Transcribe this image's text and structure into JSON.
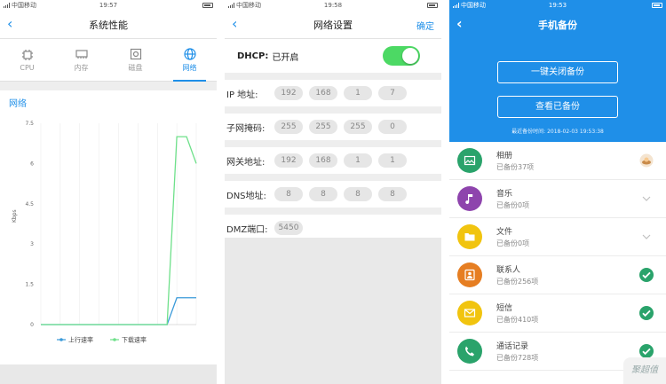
{
  "screen1": {
    "status": {
      "carrier": "中国移动",
      "time": "19:57"
    },
    "title": "系统性能",
    "tabs": [
      {
        "label": "CPU",
        "icon": "cpu-icon"
      },
      {
        "label": "内存",
        "icon": "memory-icon"
      },
      {
        "label": "磁盘",
        "icon": "disk-icon"
      },
      {
        "label": "网络",
        "icon": "globe-icon",
        "active": true
      }
    ],
    "section_title": "网络",
    "chart_data": {
      "type": "line",
      "ylabel": "Kbps",
      "ylim": [
        0,
        7.5
      ],
      "yticks": [
        "0",
        "1.5",
        "3",
        "4.5",
        "6",
        "7.5"
      ],
      "grid": "vertical",
      "legend_position": "bottom",
      "x": [
        0,
        1,
        2,
        3,
        4,
        5,
        6,
        7,
        8,
        9,
        10,
        11,
        12,
        13,
        14,
        15,
        16
      ],
      "series": [
        {
          "name": "上行速率",
          "color": "#3a9ad9",
          "values": [
            0,
            0,
            0,
            0,
            0,
            0,
            0,
            0,
            0,
            0,
            0,
            0,
            0,
            0,
            1,
            1,
            1
          ]
        },
        {
          "name": "下载速率",
          "color": "#6ee08a",
          "values": [
            0,
            0,
            0,
            0,
            0,
            0,
            0,
            0,
            0,
            0,
            0,
            0,
            0,
            0,
            7,
            7,
            6
          ]
        }
      ]
    }
  },
  "screen2": {
    "status": {
      "carrier": "中国移动",
      "time": "19:58"
    },
    "title": "网络设置",
    "confirm": "确定",
    "dhcp": {
      "label": "DHCP:",
      "value": "已开启",
      "on": true
    },
    "rows": [
      {
        "label": "IP   地址:",
        "values": [
          "192",
          "168",
          "1",
          "7"
        ]
      },
      {
        "label": "子网掩码:",
        "values": [
          "255",
          "255",
          "255",
          "0"
        ]
      },
      {
        "label": "网关地址:",
        "values": [
          "192",
          "168",
          "1",
          "1"
        ]
      },
      {
        "label": "DNS地址:",
        "values": [
          "8",
          "8",
          "8",
          "8"
        ]
      }
    ],
    "dmz": {
      "label": "DMZ端口:",
      "value": "5450"
    }
  },
  "screen3": {
    "status": {
      "carrier": "中国移动",
      "time": "19:53"
    },
    "title": "手机备份",
    "btn_close": "一键关闭备份",
    "btn_view": "查看已备份",
    "last_backup": "最近备份时间: 2018-02-03 19:53:38",
    "items": [
      {
        "title": "相册",
        "sub": "已备份37项",
        "color": "#2aa36b",
        "icon": "image-icon",
        "action": "thumb"
      },
      {
        "title": "音乐",
        "sub": "已备份0项",
        "color": "#8e44ad",
        "icon": "music-note-icon",
        "action": "chevron"
      },
      {
        "title": "文件",
        "sub": "已备份0项",
        "color": "#f1c40f",
        "icon": "folder-icon",
        "action": "chevron"
      },
      {
        "title": "联系人",
        "sub": "已备份256项",
        "color": "#e67e22",
        "icon": "person-icon",
        "action": "check"
      },
      {
        "title": "短信",
        "sub": "已备份410项",
        "color": "#f1c40f",
        "icon": "envelope-icon",
        "action": "check"
      },
      {
        "title": "通话记录",
        "sub": "已备份728项",
        "color": "#2aa36b",
        "icon": "phone-icon",
        "action": "check"
      }
    ],
    "watermark": "聚超值"
  }
}
